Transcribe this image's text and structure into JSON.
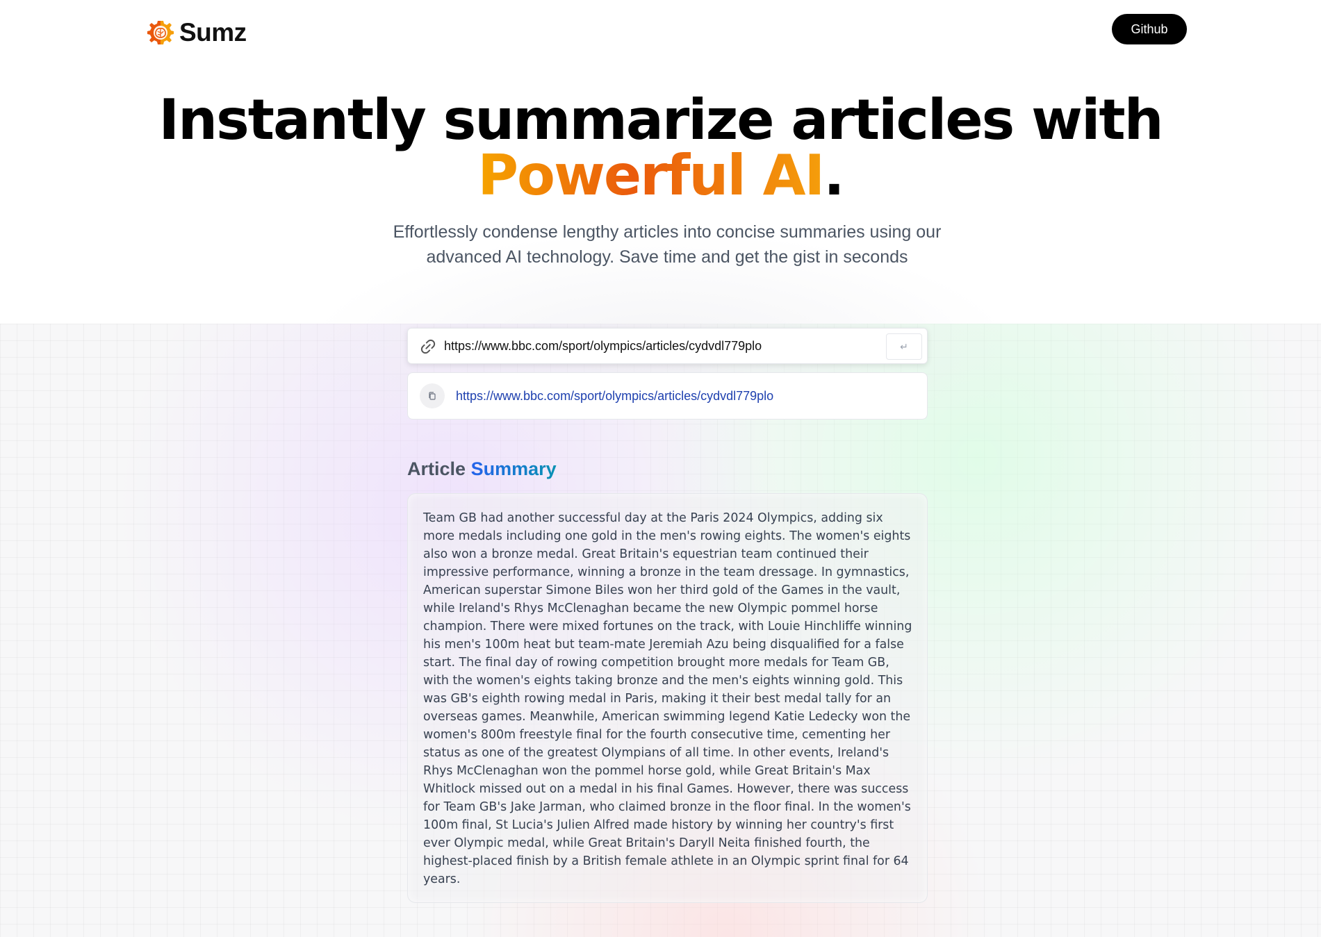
{
  "header": {
    "logo_text": "Sumz",
    "github_label": "Github"
  },
  "hero": {
    "title_line1": "Instantly summarize articles with",
    "title_accent": "Powerful AI",
    "title_period": ".",
    "subtitle": "Effortlessly condense lengthy articles into concise summaries using our advanced AI technology. Save time and get the gist in seconds"
  },
  "url_form": {
    "value": "https://www.bbc.com/sport/olympics/articles/cydvdl779plo",
    "submit_label": "↵"
  },
  "history": [
    {
      "url": "https://www.bbc.com/sport/olympics/articles/cydvdl779plo"
    }
  ],
  "summary": {
    "heading_prefix": "Article",
    "heading_accent": "Summary",
    "text": "Team GB had another successful day at the Paris 2024 Olympics, adding six more medals including one gold in the men's rowing eights. The women's eights also won a bronze medal. Great Britain's equestrian team continued their impressive performance, winning a bronze in the team dressage. In gymnastics, American superstar Simone Biles won her third gold of the Games in the vault, while Ireland's Rhys McClenaghan became the new Olympic pommel horse champion. There were mixed fortunes on the track, with Louie Hinchliffe winning his men's 100m heat but team-mate Jeremiah Azu being disqualified for a false start. The final day of rowing competition brought more medals for Team GB, with the women's eights taking bronze and the men's eights winning gold. This was GB's eighth rowing medal in Paris, making it their best medal tally for an overseas games. Meanwhile, American swimming legend Katie Ledecky won the women's 800m freestyle final for the fourth consecutive time, cementing her status as one of the greatest Olympians of all time. In other events, Ireland's Rhys McClenaghan won the pommel horse gold, while Great Britain's Max Whitlock missed out on a medal in his final Games. However, there was success for Team GB's Jake Jarman, who claimed bronze in the floor final. In the women's 100m final, St Lucia's Julien Alfred made history by winning her country's first ever Olympic medal, while Great Britain's Daryll Neita finished fourth, the highest-placed finish by a British female athlete in an Olympic sprint final for 64 years."
  },
  "colors": {
    "accent_orange": "#ea5a0c",
    "accent_blue": "#2563eb",
    "button_black": "#000000",
    "link_blue": "#1e40af"
  },
  "icons": {
    "logo": "brain-gear-logo-icon",
    "url": "link-icon",
    "copy": "copy-icon",
    "submit": "enter-icon"
  }
}
